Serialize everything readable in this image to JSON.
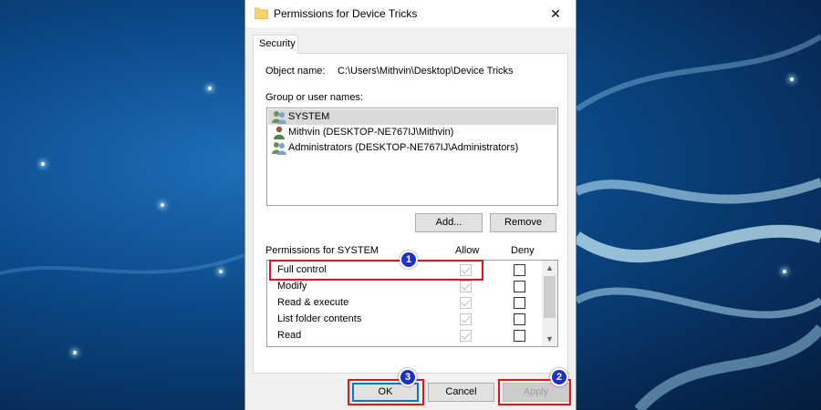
{
  "window": {
    "title": "Permissions for Device Tricks",
    "close_glyph": "✕"
  },
  "tabs": [
    {
      "label": "Security"
    }
  ],
  "object": {
    "label": "Object name:",
    "value": "C:\\Users\\Mithvin\\Desktop\\Device Tricks"
  },
  "groups": {
    "label": "Group or user names:",
    "items": [
      {
        "name": "SYSTEM",
        "selected": true,
        "icon": "user-group-icon"
      },
      {
        "name": "Mithvin (DESKTOP-NE767IJ\\Mithvin)",
        "selected": false,
        "icon": "user-icon"
      },
      {
        "name": "Administrators (DESKTOP-NE767IJ\\Administrators)",
        "selected": false,
        "icon": "user-group-icon"
      }
    ],
    "add_label": "Add...",
    "remove_label": "Remove"
  },
  "permissions": {
    "header": "Permissions for SYSTEM",
    "allow_header": "Allow",
    "deny_header": "Deny",
    "rows": [
      {
        "name": "Full control",
        "allow": true,
        "deny": false
      },
      {
        "name": "Modify",
        "allow": true,
        "deny": false
      },
      {
        "name": "Read & execute",
        "allow": true,
        "deny": false
      },
      {
        "name": "List folder contents",
        "allow": true,
        "deny": false
      },
      {
        "name": "Read",
        "allow": true,
        "deny": false
      }
    ]
  },
  "footer": {
    "ok_label": "OK",
    "cancel_label": "Cancel",
    "apply_label": "Apply"
  },
  "annotations": {
    "markers": [
      "1",
      "2",
      "3"
    ],
    "highlight_color": "#e3141b",
    "marker_color": "#1f2fc4"
  }
}
